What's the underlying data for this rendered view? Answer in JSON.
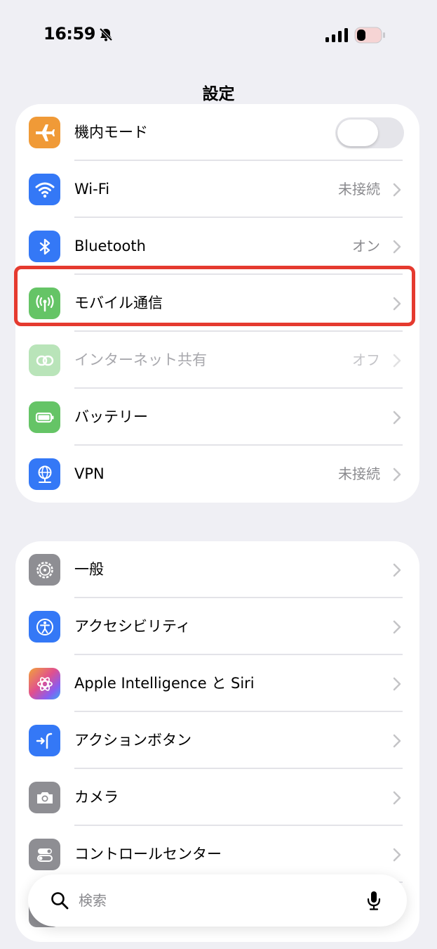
{
  "status_bar": {
    "time": "16:59",
    "silent_icon": "bell-slash-icon",
    "signal_icon": "cellular-signal-icon",
    "battery_icon": "battery-low-icon"
  },
  "page_title": "設定",
  "groups": [
    {
      "rows": [
        {
          "label": "機内モード",
          "value": "",
          "icon": "airplane-icon",
          "color": "#f09a37",
          "control": "toggle",
          "toggle_on": false
        },
        {
          "label": "Wi-Fi",
          "value": "未接続",
          "icon": "wifi-icon",
          "color": "#3478f6"
        },
        {
          "label": "Bluetooth",
          "value": "オン",
          "icon": "bluetooth-icon",
          "color": "#3478f6"
        },
        {
          "label": "モバイル通信",
          "value": "",
          "icon": "antenna-icon",
          "color": "#65c466",
          "highlighted": true
        },
        {
          "label": "インターネット共有",
          "value": "オフ",
          "icon": "link-icon",
          "color": "#65c466",
          "disabled": true
        },
        {
          "label": "バッテリー",
          "value": "",
          "icon": "battery-icon",
          "color": "#65c466"
        },
        {
          "label": "VPN",
          "value": "未接続",
          "icon": "globe-icon",
          "color": "#3478f6"
        }
      ]
    },
    {
      "rows": [
        {
          "label": "一般",
          "value": "",
          "icon": "gear-icon",
          "color": "#8e8e93"
        },
        {
          "label": "アクセシビリティ",
          "value": "",
          "icon": "accessibility-icon",
          "color": "#3478f6"
        },
        {
          "label": "Apple Intelligence と Siri",
          "value": "",
          "icon": "apple-intelligence-icon",
          "color": "#e06fa0"
        },
        {
          "label": "アクションボタン",
          "value": "",
          "icon": "action-button-icon",
          "color": "#3478f6"
        },
        {
          "label": "カメラ",
          "value": "",
          "icon": "camera-icon",
          "color": "#8e8e93"
        },
        {
          "label": "コントロールセンター",
          "value": "",
          "icon": "control-center-icon",
          "color": "#8e8e93"
        },
        {
          "label": "",
          "value": "",
          "icon": "partial-row-icon",
          "color": "#8e8e93"
        }
      ]
    }
  ],
  "search": {
    "placeholder": "検索",
    "icon": "search-icon",
    "mic_icon": "microphone-icon"
  },
  "highlight_color": "#e53a2f"
}
